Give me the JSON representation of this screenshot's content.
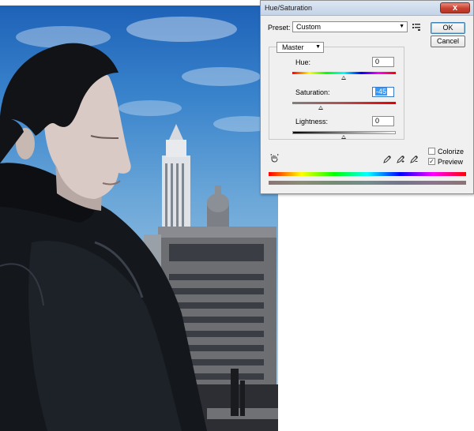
{
  "dialog": {
    "title": "Hue/Saturation",
    "close_glyph": "x",
    "preset_label": "Preset:",
    "preset_value": "Custom",
    "ok_label": "OK",
    "cancel_label": "Cancel",
    "channel_value": "Master",
    "hue": {
      "label": "Hue:",
      "value": "0"
    },
    "saturation": {
      "label": "Saturation:",
      "value": "-45"
    },
    "lightness": {
      "label": "Lightness:",
      "value": "0"
    },
    "colorize": {
      "label": "Colorize",
      "checked": false
    },
    "preview": {
      "label": "Preview",
      "checked": true,
      "mark": "✓"
    },
    "icons": [
      "hand-adjust-icon",
      "eyedropper-icon",
      "eyedropper-plus-icon",
      "eyedropper-minus-icon",
      "preset-options-icon"
    ]
  },
  "colors": {
    "titlebar": "#c8d7ea",
    "close_button": "#c8412f",
    "selection": "#3399ff"
  }
}
